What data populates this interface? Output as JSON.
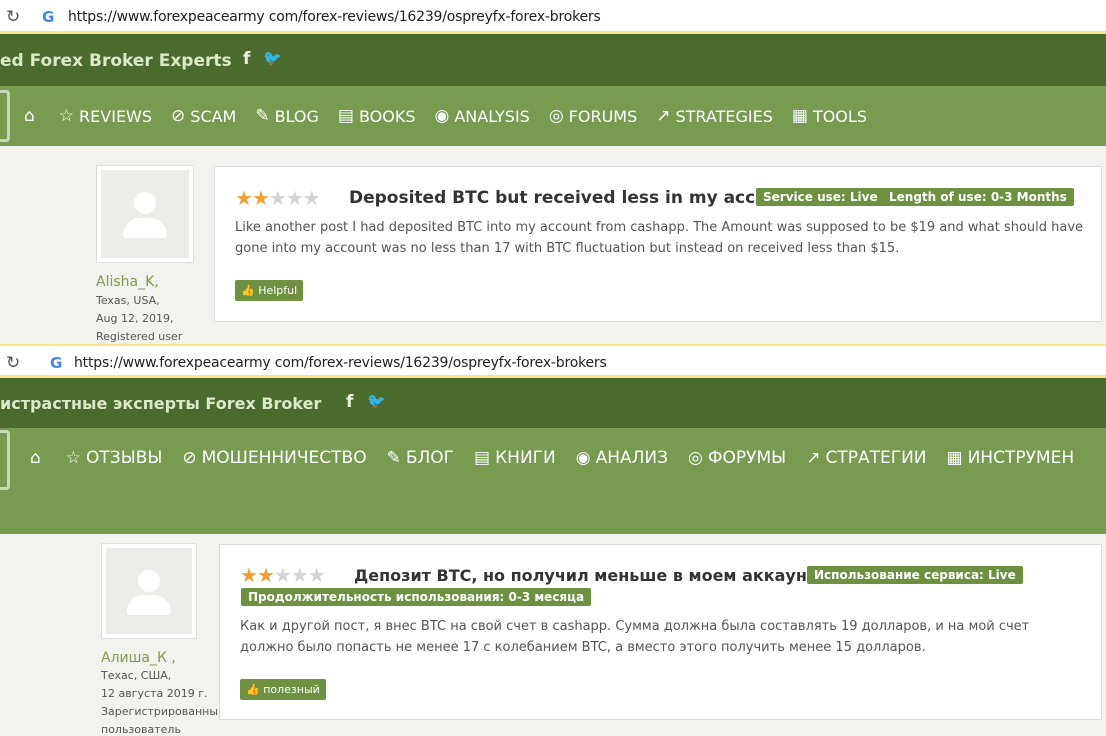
{
  "en": {
    "url": "https://www.forexpeacearmy com/forex-reviews/16239/ospreyfx-forex-brokers",
    "brand": "ed Forex Broker Experts",
    "social": [
      "f",
      "🐦"
    ],
    "nav": [
      {
        "icon": "⌂",
        "label": ""
      },
      {
        "icon": "☆",
        "label": "REVIEWS"
      },
      {
        "icon": "⊘",
        "label": "SCAM"
      },
      {
        "icon": "✎",
        "label": "BLOG"
      },
      {
        "icon": "▤",
        "label": "BOOKS"
      },
      {
        "icon": "◉",
        "label": "ANALYSIS"
      },
      {
        "icon": "◎",
        "label": "FORUMS"
      },
      {
        "icon": "↗",
        "label": "STRATEGIES"
      },
      {
        "icon": "▦",
        "label": "TOOLS"
      }
    ],
    "user": {
      "name": "Alisha_K,",
      "location": "Texas, USA,",
      "date": "Aug 12, 2019,",
      "role": "Registered user"
    },
    "review": {
      "rating": 2,
      "max_rating": 5,
      "title": "Deposited BTC but received less in my account",
      "badges": [
        "Service use: Live",
        "Length of use: 0-3 Months"
      ],
      "body": "Like another post I had deposited BTC into my account from cashapp. The Amount was supposed to be $19 and what should have gone into my account was no less than 17 with BTC fluctuation but instead on received less than $15.",
      "helpful": "👍 Helpful"
    }
  },
  "ru": {
    "url": "https://www.forexpeacearmy com/forex-reviews/16239/ospreyfx-forex-brokers",
    "brand": "истрастные эксперты Forex Broker",
    "social": [
      "f",
      "🐦"
    ],
    "nav": [
      {
        "icon": "⌂",
        "label": ""
      },
      {
        "icon": "☆",
        "label": "ОТЗЫВЫ"
      },
      {
        "icon": "⊘",
        "label": "МОШЕННИЧЕСТВО"
      },
      {
        "icon": "✎",
        "label": "БЛОГ"
      },
      {
        "icon": "▤",
        "label": "КНИГИ"
      },
      {
        "icon": "◉",
        "label": "АНАЛИЗ"
      },
      {
        "icon": "◎",
        "label": "ФОРУМЫ"
      },
      {
        "icon": "↗",
        "label": "СТРАТЕГИИ"
      },
      {
        "icon": "▦",
        "label": "ИНСТРУМЕН"
      }
    ],
    "user": {
      "name": "Алиша_К ,",
      "location": "Техас, США,",
      "date": "12 августа 2019 г.",
      "role": "Зарегистрированный пользователь"
    },
    "review": {
      "rating": 2,
      "max_rating": 5,
      "title": "Депозит BTC, но получил меньше в моем аккаунте",
      "badges": [
        "Использование сервиса: Live",
        "Продолжительность использования: 0-3 месяца"
      ],
      "body": "Как и другой пост, я внес BTC на свой счет в cashapp. Сумма должна была составлять 19 долларов, и на мой счет должно было попасть не менее 17 с колебанием BTC, а вместо этого получить менее 15 долларов.",
      "helpful": "👍 полезный"
    }
  },
  "colors": {
    "topbar": "#4a6a2e",
    "navbar": "#789b52",
    "badge": "#6d9140",
    "star_on": "#f0a030",
    "star_off": "#d4d4d4"
  }
}
